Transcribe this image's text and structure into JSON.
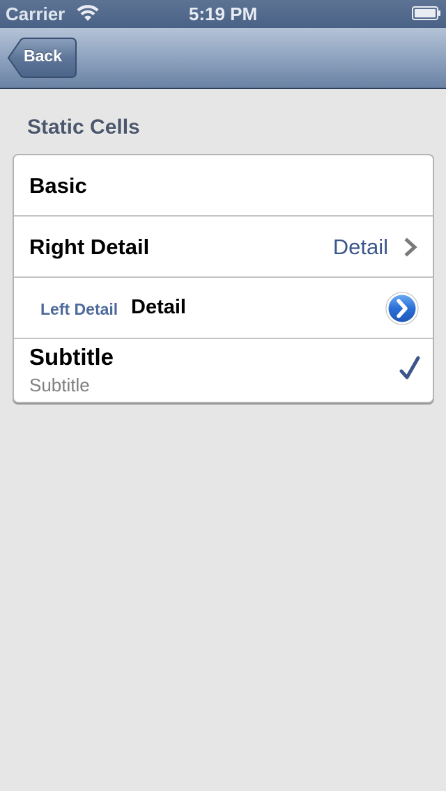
{
  "status_bar": {
    "carrier": "Carrier",
    "time": "5:19 PM",
    "icons": [
      "wifi-icon",
      "battery-icon"
    ]
  },
  "nav_bar": {
    "back_label": "Back"
  },
  "section": {
    "header": "Static Cells"
  },
  "cells": [
    {
      "title": "Basic"
    },
    {
      "title": "Right Detail",
      "detail": "Detail",
      "accessory": "chevron-right-icon"
    },
    {
      "label": "Left Detail",
      "detail": "Detail",
      "accessory": "detail-disclosure-icon"
    },
    {
      "title": "Subtitle",
      "subtitle": "Subtitle",
      "accessory": "checkmark-icon"
    }
  ],
  "colors": {
    "nav_bar": "#7a90ae",
    "background": "#e6e6e6",
    "detail_text": "#3a568a",
    "left_detail_label": "#4d6a9a",
    "checkmark": "#3a568a",
    "disclosure_button": "#2a6fd6"
  }
}
